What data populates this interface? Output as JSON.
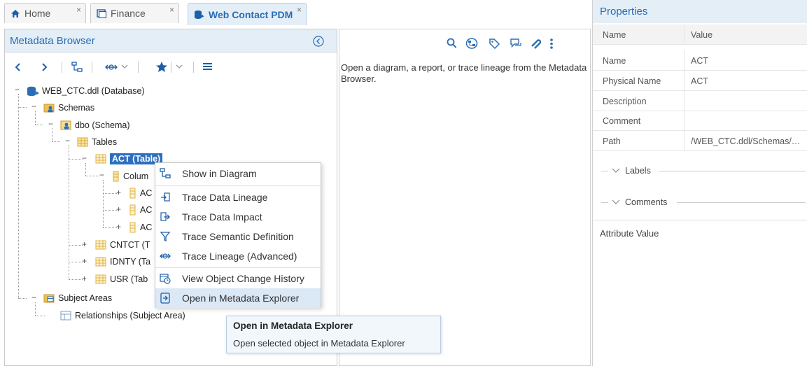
{
  "tabs": [
    {
      "label": "Home",
      "close": "×",
      "icon": "home-icon"
    },
    {
      "label": "Finance",
      "close": "×",
      "icon": "window-icon"
    },
    {
      "label": "Web Contact PDM",
      "close": "×",
      "icon": "database-icon"
    }
  ],
  "metadata_browser": {
    "title": "Metadata Browser",
    "toolbar_icons": [
      "back-icon",
      "forward-icon",
      "diagram-icon",
      "lineage-icon",
      "chevron-down-icon",
      "star-icon",
      "chevron-down-icon",
      "list-icon"
    ]
  },
  "tree": [
    {
      "label": "WEB_CTC.ddl (Database)"
    },
    {
      "label": "Schemas"
    },
    {
      "label": "dbo (Schema)"
    },
    {
      "label": "Tables"
    },
    {
      "label": "ACT (Table)"
    },
    {
      "label": "Colum"
    },
    {
      "label": "AC"
    },
    {
      "label": "AC"
    },
    {
      "label": "AC"
    },
    {
      "label": "CNTCT (T"
    },
    {
      "label": "IDNTY (Ta"
    },
    {
      "label": "USR (Tab"
    },
    {
      "label": "Subject Areas"
    },
    {
      "label": "Relationships (Subject Area)"
    }
  ],
  "middle": {
    "hint": "Open a diagram, a report, or trace lineage from the Metadata Browser.",
    "toolbar_icons": [
      "search-icon",
      "diagram-icon",
      "tag-icon",
      "comment-icon",
      "attachment-icon",
      "more-icon"
    ]
  },
  "context_menu": [
    {
      "label": "Show in Diagram",
      "icon": "diagram-icon"
    },
    {
      "label": "Trace Data Lineage",
      "icon": "lineage-in-icon"
    },
    {
      "label": "Trace Data Impact",
      "icon": "impact-icon"
    },
    {
      "label": "Trace Semantic Definition",
      "icon": "semantic-icon"
    },
    {
      "label": "Trace Lineage (Advanced)",
      "icon": "lineage-advanced-icon"
    },
    {
      "label": "View Object Change History",
      "icon": "history-icon"
    },
    {
      "label": "Open in Metadata Explorer",
      "icon": "explorer-icon"
    }
  ],
  "tooltip": {
    "title": "Open in Metadata Explorer",
    "text": "Open selected object in Metadata Explorer"
  },
  "properties": {
    "title": "Properties",
    "header": {
      "name": "Name",
      "value": "Value"
    },
    "rows": [
      {
        "name": "Name",
        "value": "ACT"
      },
      {
        "name": "Physical Name",
        "value": "ACT"
      },
      {
        "name": "Description",
        "value": ""
      },
      {
        "name": "Comment",
        "value": ""
      },
      {
        "name": "Path",
        "value": "/WEB_CTC.ddl/Schemas/dbo/Tables/ACT"
      }
    ],
    "sections": [
      "Labels",
      "Comments"
    ],
    "attribute_value": "Attribute Value"
  },
  "colors": {
    "accent": "#2a6db5",
    "header_bg": "#e4eef7",
    "selection": "#2c6fc0",
    "table_icon": "#e8b94a"
  }
}
